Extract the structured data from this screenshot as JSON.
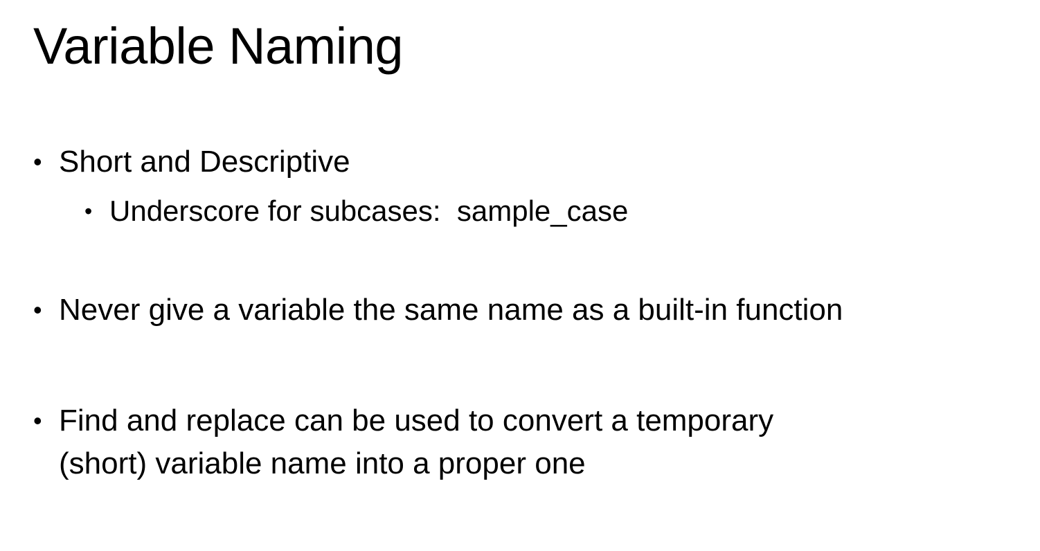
{
  "slide": {
    "title": "Variable Naming",
    "bullet_char": "•",
    "bullets": [
      {
        "text": "Short and Descriptive"
      },
      {
        "text": "Underscore for subcases:  sample_case"
      },
      {
        "text": "Never give a variable the same name as a built-in function"
      },
      {
        "line1": "Find and replace can be used to convert a temporary",
        "line2": "(short) variable name into a proper one"
      }
    ]
  }
}
